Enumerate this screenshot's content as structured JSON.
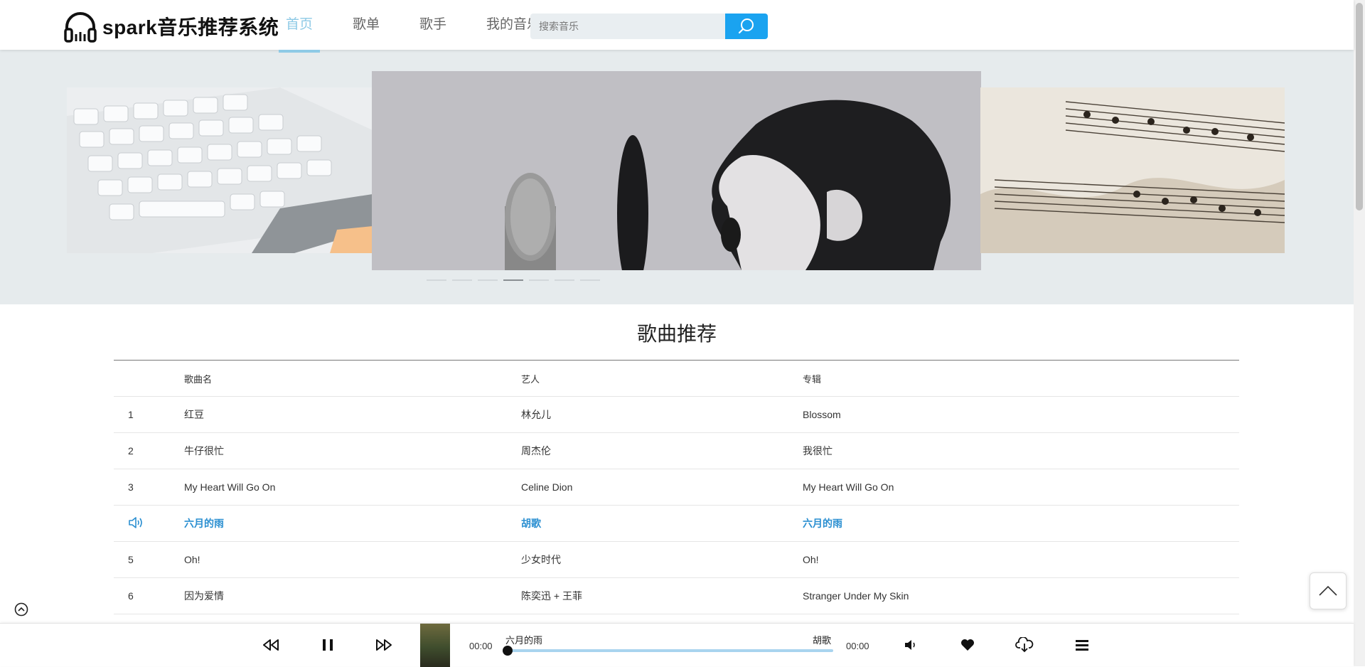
{
  "app": {
    "logo_text": "spark音乐推荐系统"
  },
  "nav": [
    {
      "label": "首页",
      "active": true
    },
    {
      "label": "歌单",
      "active": false
    },
    {
      "label": "歌手",
      "active": false
    },
    {
      "label": "我的音乐",
      "active": false
    }
  ],
  "search": {
    "placeholder": "搜索音乐"
  },
  "carousel": {
    "slide_count": 7,
    "active_index": 3
  },
  "section": {
    "title": "歌曲推荐"
  },
  "table": {
    "headers": [
      "",
      "歌曲名",
      "艺人",
      "专辑"
    ],
    "rows": [
      {
        "index": "1",
        "name": "红豆",
        "artist": "林允儿",
        "album": "Blossom",
        "playing": false
      },
      {
        "index": "2",
        "name": "牛仔很忙",
        "artist": "周杰伦",
        "album": "我很忙",
        "playing": false
      },
      {
        "index": "3",
        "name": "My Heart Will Go On",
        "artist": "Celine Dion",
        "album": "My Heart Will Go On",
        "playing": false
      },
      {
        "index": "",
        "name": "六月的雨",
        "artist": "胡歌",
        "album": "六月的雨",
        "playing": true
      },
      {
        "index": "5",
        "name": "Oh!",
        "artist": "少女时代",
        "album": "Oh!",
        "playing": false
      },
      {
        "index": "6",
        "name": "因为爱情",
        "artist": "陈奕迅 + 王菲",
        "album": "Stranger Under My Skin",
        "playing": false
      }
    ]
  },
  "player": {
    "current_time": "00:00",
    "total_time": "00:00",
    "song_title": "六月的雨",
    "song_artist": "胡歌",
    "progress": 0.0
  },
  "colors": {
    "accent": "#8ecae6",
    "search_button": "#1aa3f0",
    "playing_text": "#2b8fd1"
  }
}
